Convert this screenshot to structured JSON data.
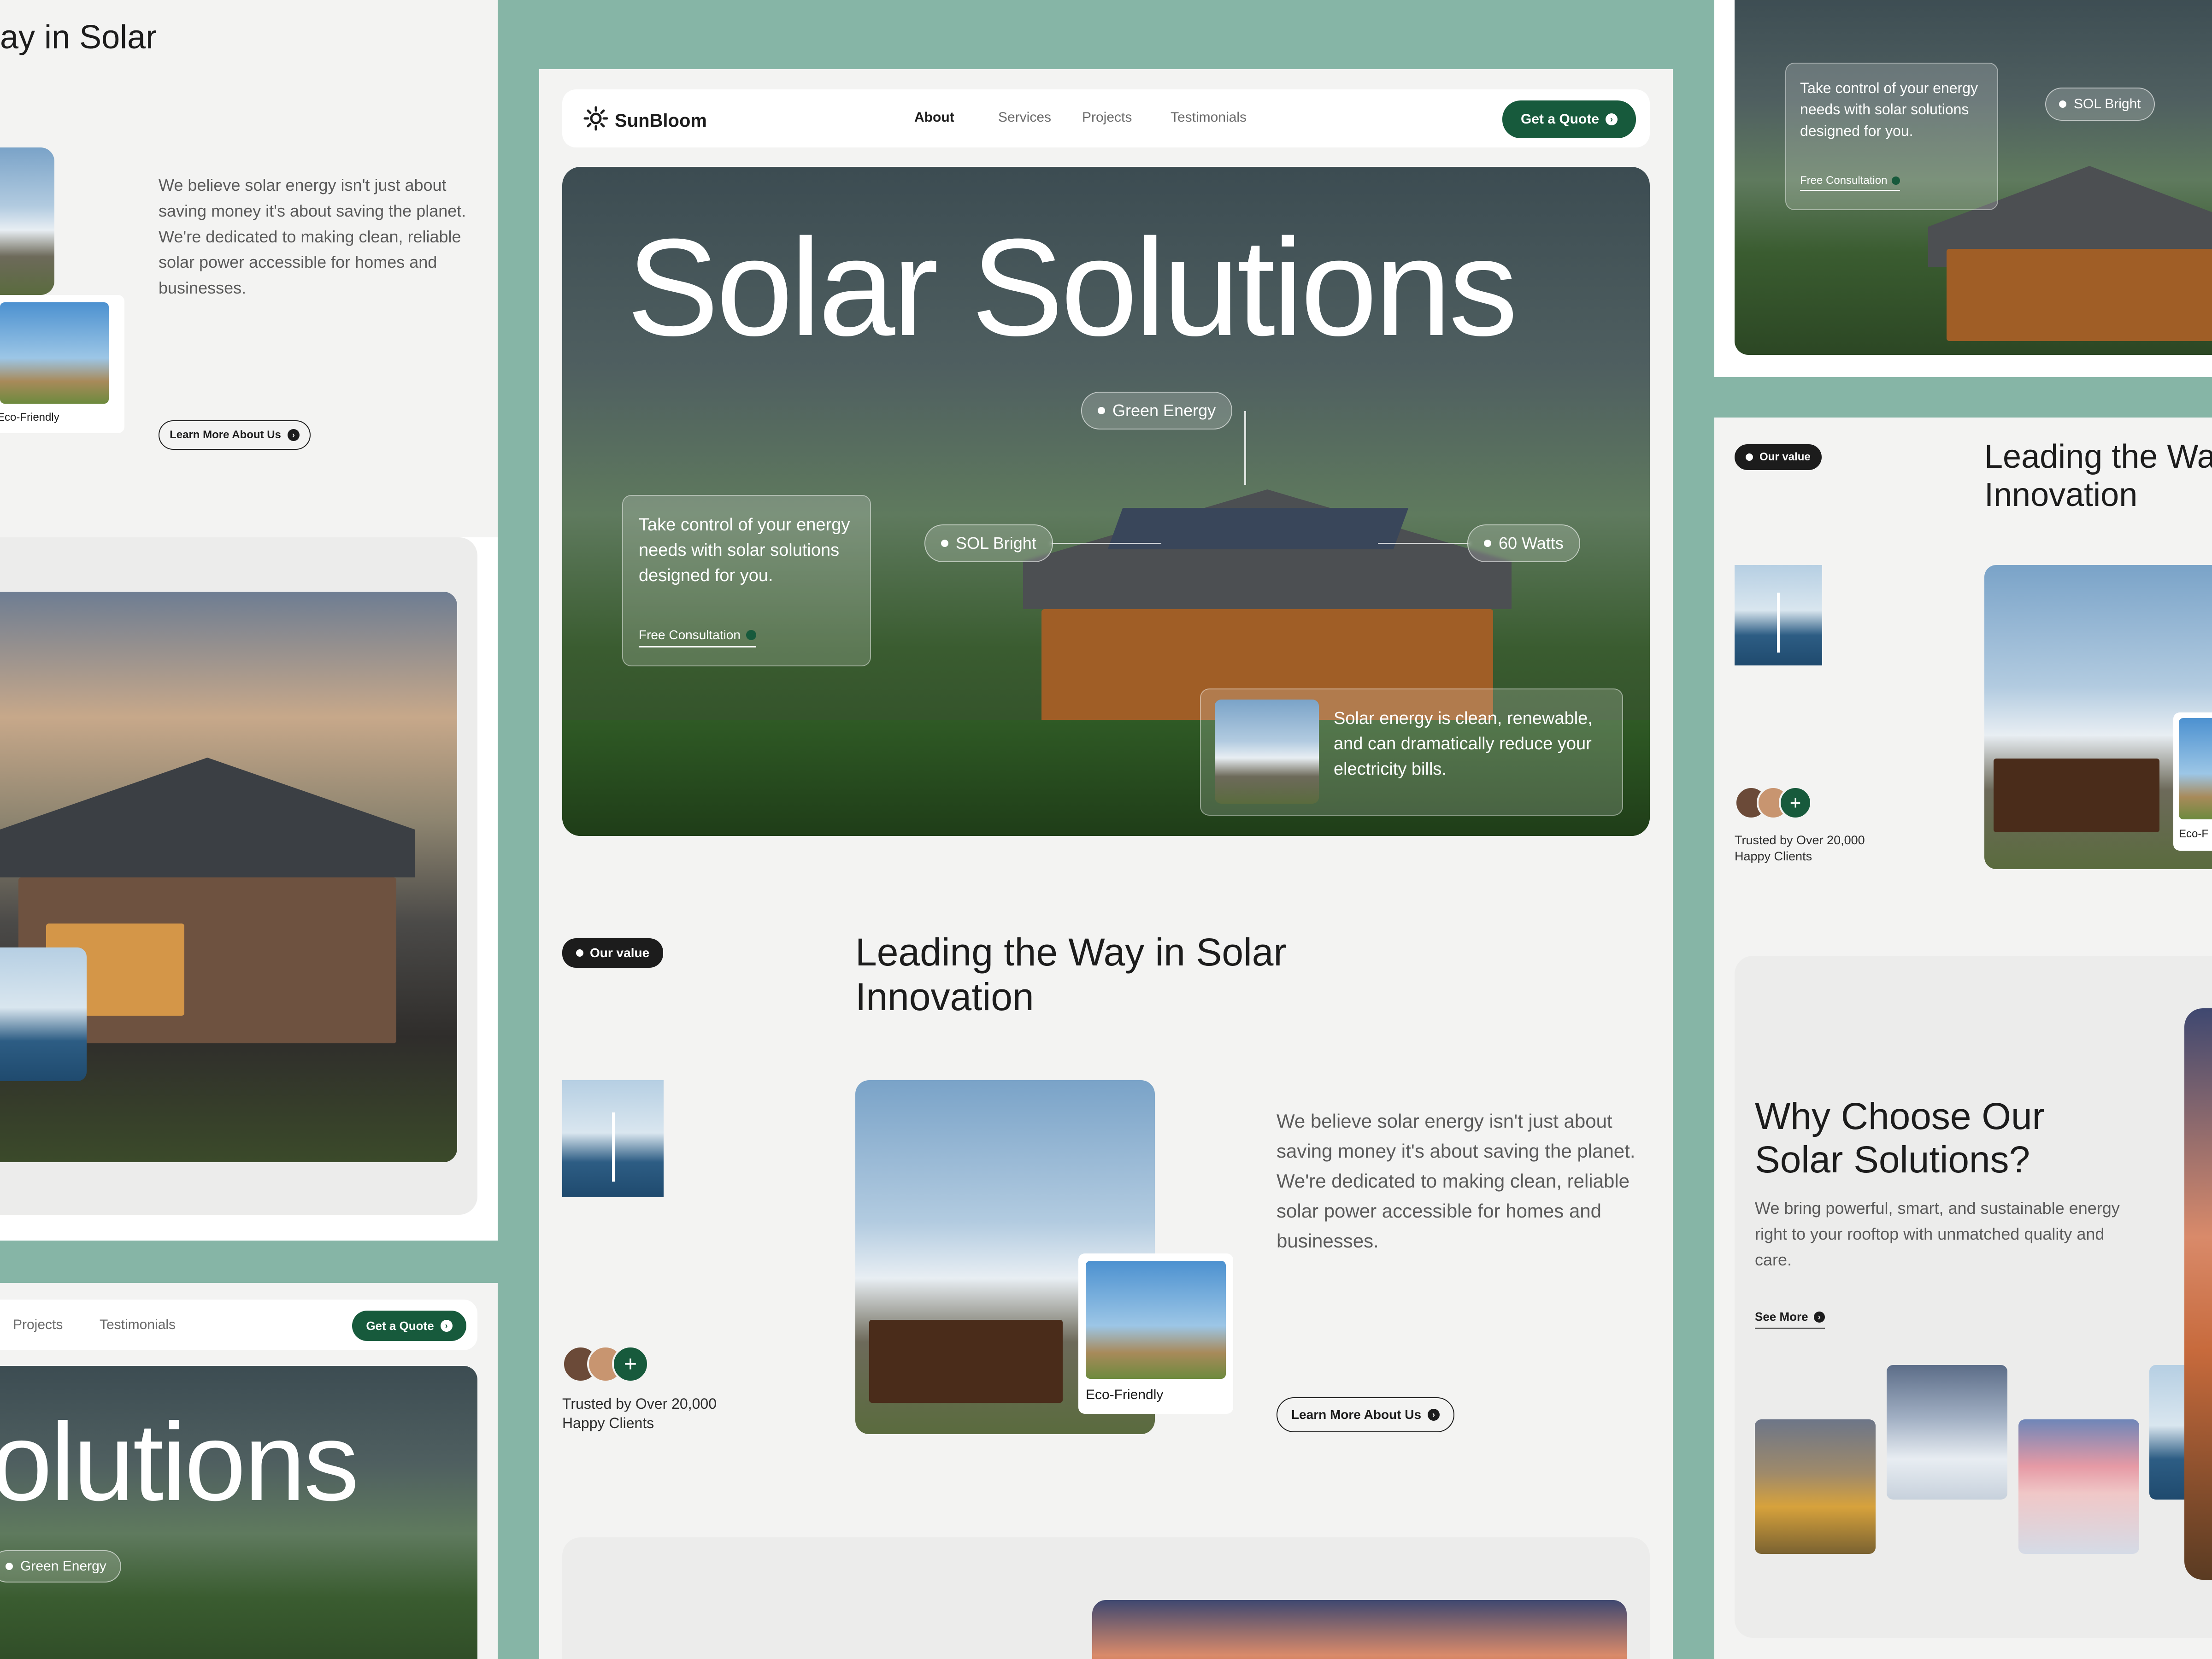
{
  "brand": {
    "name": "SunBloom",
    "accent": "#175a3c"
  },
  "nav": {
    "links": [
      "About",
      "Services",
      "Projects",
      "Testimonials"
    ],
    "active": "About",
    "cta": "Get a Quote"
  },
  "hero": {
    "title": "Solar Solutions",
    "pills": [
      "Green Energy",
      "SOL Bright",
      "60 Watts"
    ],
    "card_text": "Take control of your energy needs with solar solutions designed for you.",
    "card_link": "Free Consultation",
    "info_text": "Solar energy is clean, renewable, and can dramatically reduce your electricity bills."
  },
  "value": {
    "badge": "Our value",
    "heading_line1": "Leading the Way in Solar",
    "heading_line2": "Innovation",
    "paragraph": "We believe solar energy isn't just about saving money it's about saving the planet. We're dedicated to making clean, reliable solar power accessible for homes and businesses.",
    "eco_label": "Eco-Friendly",
    "trusted_line1": "Trusted by Over 20,000",
    "trusted_line2": "Happy Clients",
    "learn_more": "Learn More About Us"
  },
  "left_panel": {
    "heading_fragment": "ay in Solar",
    "eco_label": "Eco-Friendly",
    "learn_more": "Learn More About Us"
  },
  "left_bottom": {
    "nav_links": [
      "Projects",
      "Testimonials"
    ],
    "cta": "Get a Quote",
    "title_fragment": "olutions",
    "pill": "Green Energy"
  },
  "right_top": {
    "card_text": "Take control of your energy needs with solar solutions designed for you.",
    "card_link": "Free Consultation",
    "pill": "SOL Bright"
  },
  "right_mid": {
    "badge": "Our value",
    "heading_line1": "Leading the Way",
    "heading_line2": "Innovation",
    "trusted_line1": "Trusted by Over 20,000",
    "trusted_line2": "Happy Clients",
    "eco_fragment": "Eco-F"
  },
  "why": {
    "heading_line1": "Why Choose Our",
    "heading_line2": "Solar Solutions?",
    "paragraph": "We bring powerful, smart, and sustainable energy right to your rooftop with unmatched quality and care.",
    "see_more": "See More"
  }
}
